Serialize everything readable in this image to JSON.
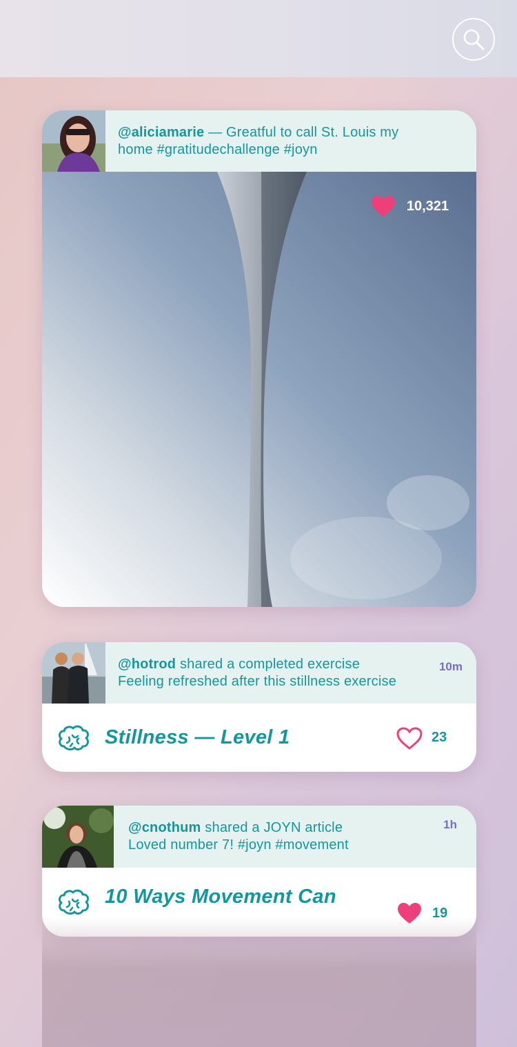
{
  "colors": {
    "accent": "#13979e",
    "time": "#7b6bd0",
    "heart": "#ef3f7a",
    "header_bg": "#e6f2ef"
  },
  "header": {
    "search_icon": "search-icon"
  },
  "posts": [
    {
      "username": "@aliciamarie",
      "separator": " — ",
      "caption": "Greatful to call St. Louis my home #gratitudechallenge #joyn",
      "likes": "10,321",
      "liked": true
    },
    {
      "username": "@hotrod",
      "action": " shared a completed exercise",
      "caption": "Feeling refreshed after this stillness exercise",
      "time": "10m",
      "title": "Stillness — Level 1",
      "likes": "23",
      "liked": false,
      "icon": "brain-icon"
    },
    {
      "username": "@cnothum",
      "action": " shared a JOYN article",
      "caption": "Loved number 7! #joyn #movement",
      "time": "1h",
      "title": "10 Ways Movement Can",
      "likes": "19",
      "liked": true,
      "icon": "brain-icon"
    }
  ]
}
